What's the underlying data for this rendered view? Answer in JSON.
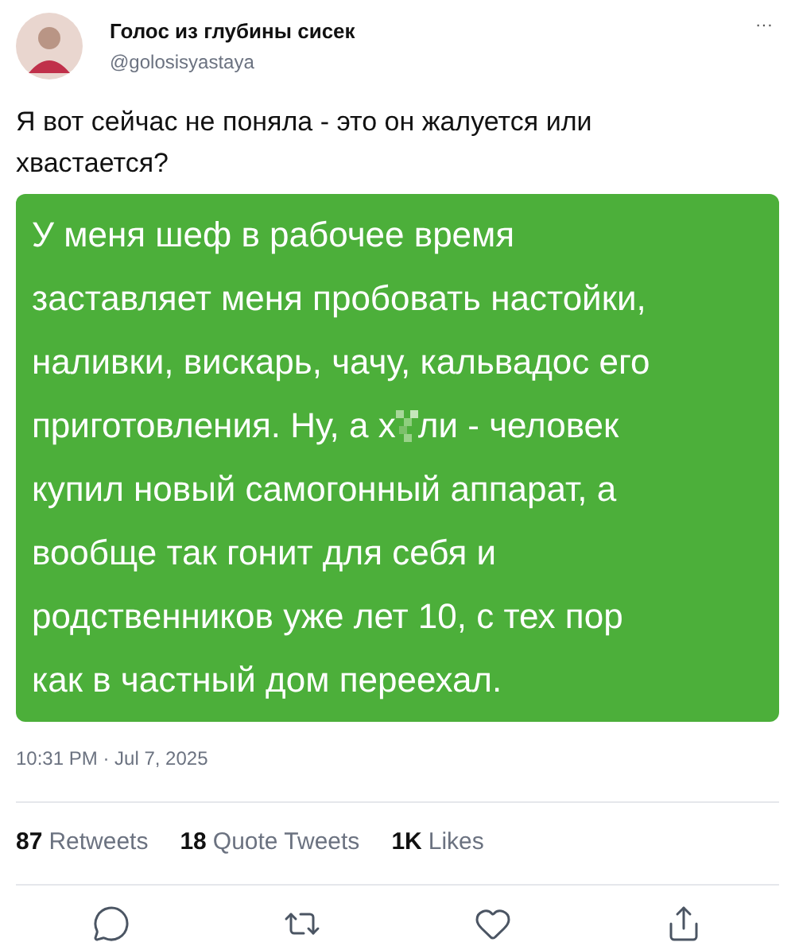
{
  "author": {
    "name": "Голос из глубины сисек",
    "handle": "@golosisyastaya"
  },
  "more": "···",
  "text": "Я вот сейчас не поняла - это он жалуется или хвастается?",
  "image_lines": [
    [
      {
        "kind": "text",
        "text": "У меня шеф в рабочее время"
      }
    ],
    [
      {
        "kind": "text",
        "text": "заставляет меня пробовать настойки,"
      }
    ],
    [
      {
        "kind": "text",
        "text": "наливки, вискарь, чачу, кальвадос его"
      }
    ],
    [
      {
        "kind": "text",
        "text": "приготовления. Ну, а х"
      },
      {
        "kind": "censor"
      },
      {
        "kind": "text",
        "text": "ли - человек"
      }
    ],
    [
      {
        "kind": "text",
        "text": "купил новый самогонный аппарат, а"
      }
    ],
    [
      {
        "kind": "text",
        "text": "вообще так гонит для себя и"
      }
    ],
    [
      {
        "kind": "text",
        "text": "родственников уже лет 10, с тех пор"
      }
    ],
    [
      {
        "kind": "text",
        "text": "как в частный дом переехал."
      }
    ]
  ],
  "timestamp": "10:31 PM · Jul 7, 2025",
  "stats": [
    {
      "count": "87",
      "label": "Retweets"
    },
    {
      "count": "18",
      "label": "Quote Tweets"
    },
    {
      "count": "1K",
      "label": "Likes"
    }
  ],
  "actions": [
    {
      "kind": "reply"
    },
    {
      "kind": "retweet"
    },
    {
      "kind": "like"
    },
    {
      "kind": "share"
    }
  ]
}
